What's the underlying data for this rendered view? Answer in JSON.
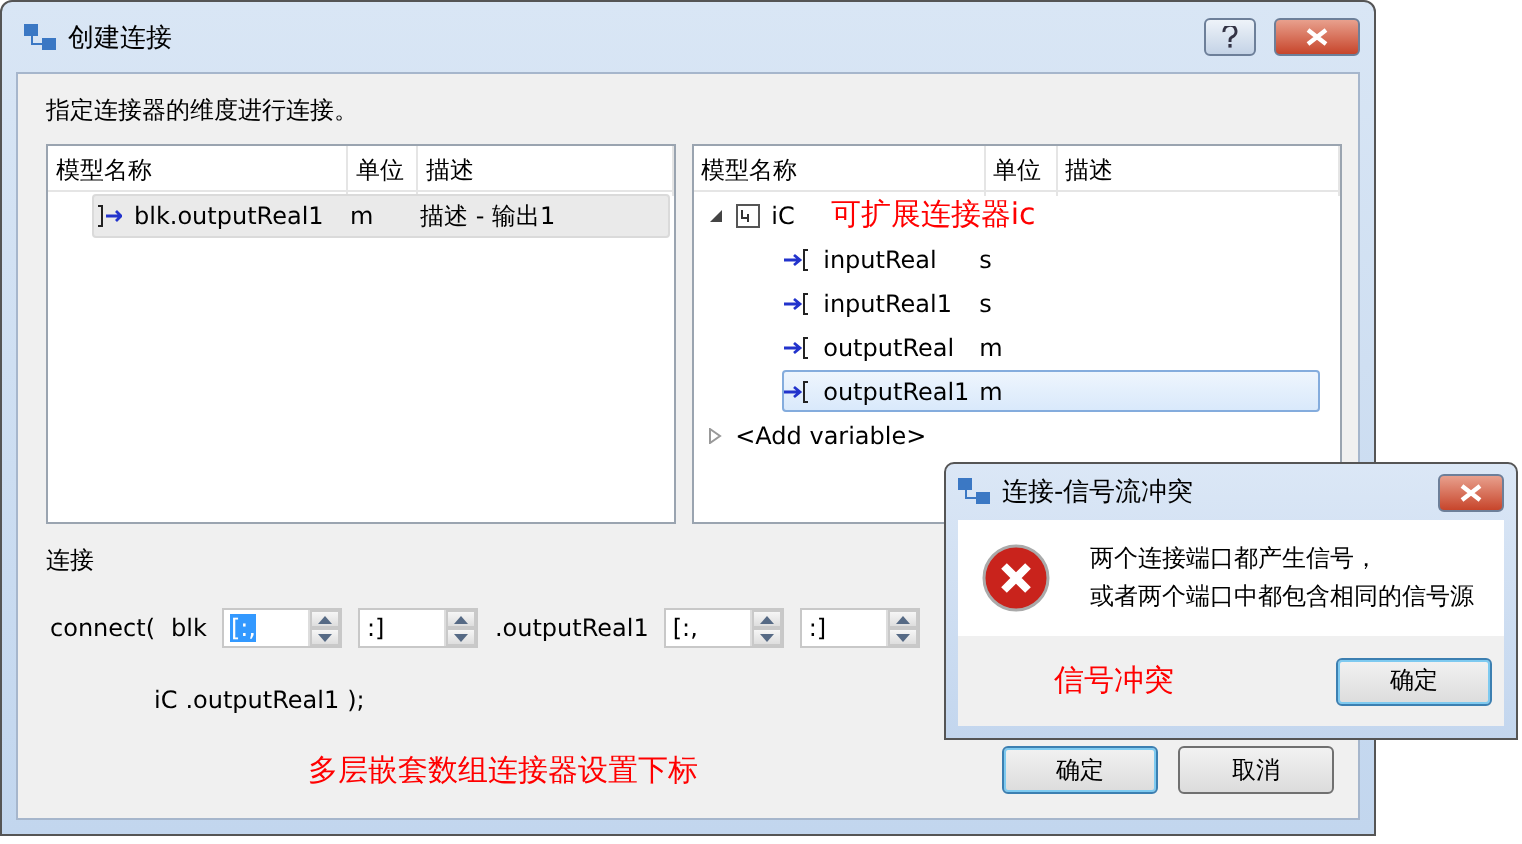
{
  "window": {
    "title": "创建连接"
  },
  "instruction": "指定连接器的维度进行连接。",
  "left_table": {
    "columns": [
      "模型名称",
      "单位",
      "描述"
    ],
    "rows": [
      {
        "name": "blk.outputReal1",
        "unit": "m",
        "description": "描述 - 输出1",
        "selected": true
      }
    ]
  },
  "right_tree": {
    "columns": [
      "模型名称",
      "单位",
      "描述"
    ],
    "items": [
      {
        "kind": "connector",
        "name": "iC",
        "expanded": true,
        "annotation": "可扩展连接器ic",
        "children": [
          {
            "kind": "port",
            "name": "inputReal",
            "unit": "s",
            "selected": false
          },
          {
            "kind": "port",
            "name": "inputReal1",
            "unit": "s",
            "selected": false
          },
          {
            "kind": "port",
            "name": "outputReal",
            "unit": "m",
            "selected": false
          },
          {
            "kind": "port",
            "name": "outputReal1",
            "unit": "m",
            "selected": true
          }
        ]
      },
      {
        "kind": "add",
        "name": "<Add variable>",
        "expanded": false
      }
    ]
  },
  "connection": {
    "label": "连接",
    "line1": [
      {
        "kind": "text",
        "text": "connect("
      },
      {
        "kind": "text",
        "text": "blk"
      },
      {
        "kind": "spin",
        "value": "[:,",
        "selected": true
      },
      {
        "kind": "spin",
        "value": ":]",
        "selected": false
      },
      {
        "kind": "text",
        "text": ".outputReal1"
      },
      {
        "kind": "spin",
        "value": "[:,",
        "selected": false
      },
      {
        "kind": "spin",
        "value": ":]",
        "selected": false
      }
    ],
    "line2": [
      "iC",
      ".outputReal1",
      ");"
    ]
  },
  "annotation": "多层嵌套数组连接器设置下标",
  "buttons": [
    {
      "label": "确定",
      "default": true
    },
    {
      "label": "取消",
      "default": false
    }
  ],
  "alert": {
    "title": "连接-信号流冲突",
    "message": [
      "两个连接端口都产生信号，",
      "或者两个端口中都包含相同的信号源"
    ],
    "annotation": "信号冲突",
    "button": "确定"
  }
}
